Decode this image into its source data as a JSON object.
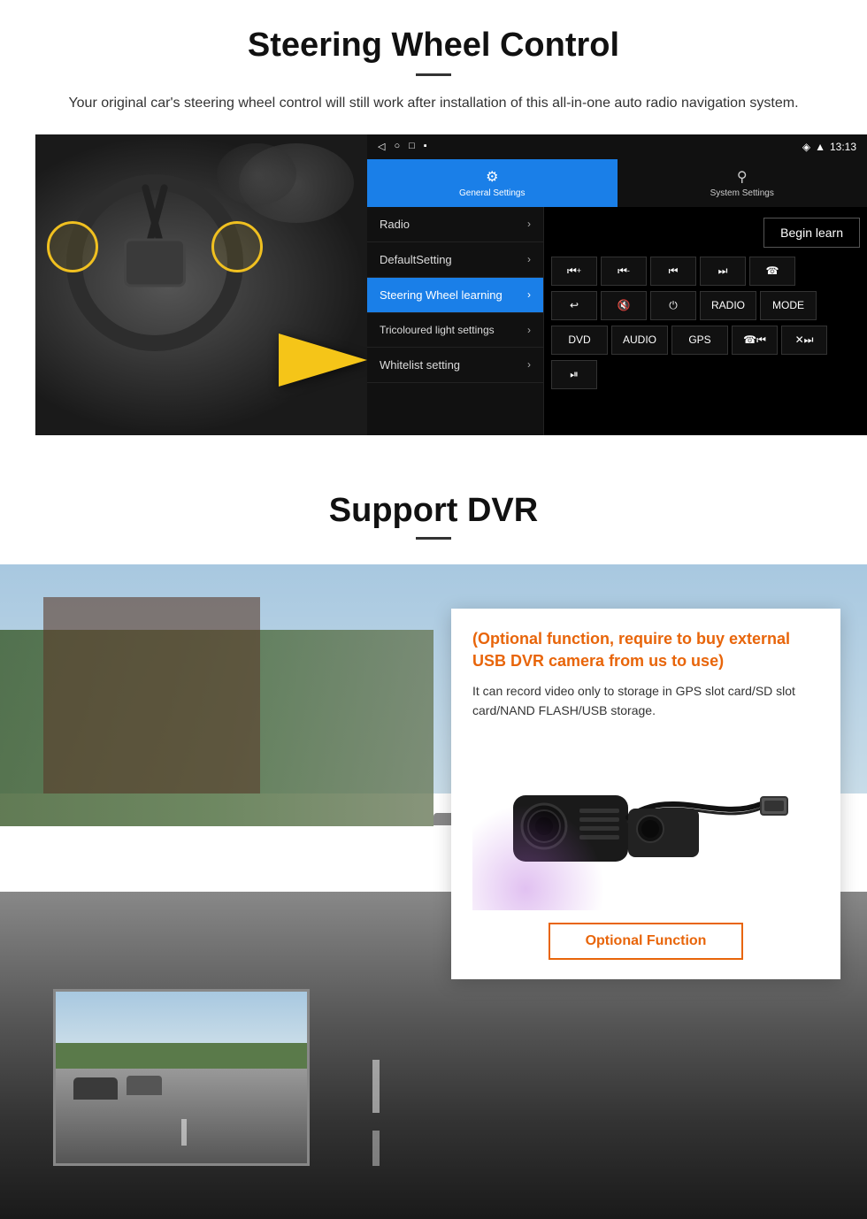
{
  "section1": {
    "title": "Steering Wheel Control",
    "divider": true,
    "subtitle": "Your original car's steering wheel control will still work after installation of this all-in-one auto radio navigation system.",
    "statusbar": {
      "nav_icons": "◁  ○  □  ▪",
      "time": "13:13",
      "signal_icon": "signal"
    },
    "tabs": [
      {
        "icon": "⚙",
        "label": "General Settings",
        "active": true
      },
      {
        "icon": "⚲",
        "label": "System Settings",
        "active": false
      }
    ],
    "settings_list": [
      {
        "label": "Radio",
        "active": false
      },
      {
        "label": "DefaultSetting",
        "active": false
      },
      {
        "label": "Steering Wheel learning",
        "active": true
      },
      {
        "label": "Tricoloured light settings",
        "active": false
      },
      {
        "label": "Whitelist setting",
        "active": false
      }
    ],
    "begin_learn_label": "Begin learn",
    "control_buttons_row1": [
      "⏮+",
      "⏮-",
      "⏮",
      "⏭",
      "☎"
    ],
    "control_buttons_row2": [
      "↩",
      "🔇x",
      "⏻",
      "RADIO",
      "MODE"
    ],
    "control_buttons_row3": [
      "DVD",
      "AUDIO",
      "GPS",
      "☎⏮",
      "✕⏭"
    ],
    "control_buttons_row4": [
      "🎬"
    ]
  },
  "section2": {
    "title": "Support DVR",
    "divider": true,
    "info_card": {
      "optional_title": "(Optional function, require to buy external USB DVR camera from us to use)",
      "description": "It can record video only to storage in GPS slot card/SD slot card/NAND FLASH/USB storage."
    },
    "optional_button_label": "Optional Function"
  }
}
